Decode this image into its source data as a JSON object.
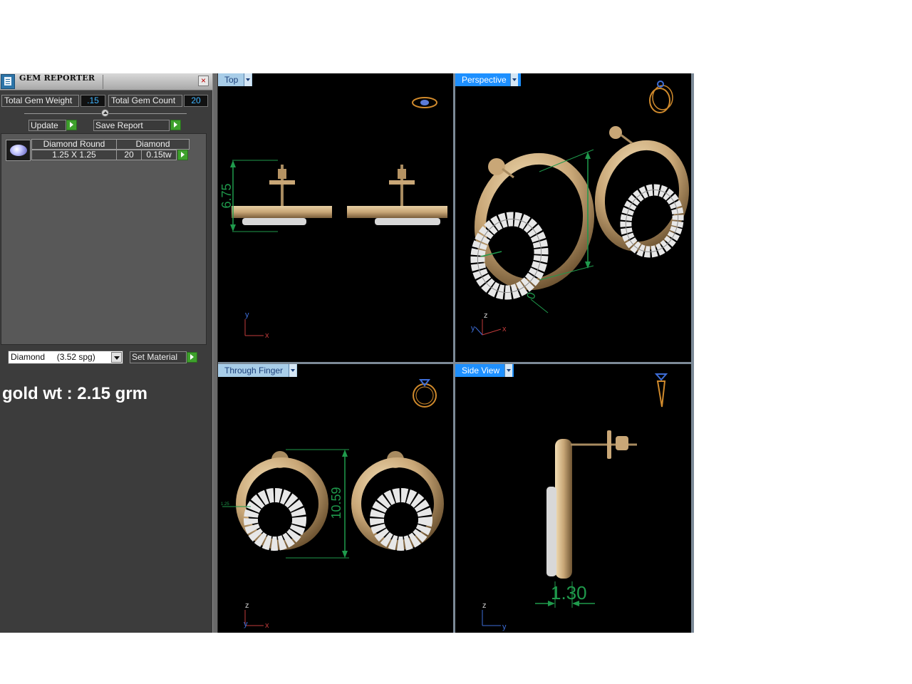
{
  "gem_reporter": {
    "title": "GEM REPORTER",
    "close": "×",
    "total_gem_weight_label": "Total Gem Weight",
    "total_gem_weight_value": ".15",
    "total_gem_count_label": "Total Gem Count",
    "total_gem_count_value": "20",
    "update_label": "Update",
    "save_report_label": "Save Report",
    "gems": [
      {
        "shape": "Diamond Round",
        "material": "Diamond",
        "size": "1.25 X 1.25",
        "count": "20",
        "weight": "0.15tw"
      }
    ]
  },
  "material": {
    "selected": "Diamond     (3.52 spg)",
    "set_material_label": "Set Material"
  },
  "gold_weight_text": "gold wt : 2.15 grm",
  "viewports": {
    "top": {
      "label": "Top",
      "dimension": "6.75"
    },
    "perspective": {
      "label": "Perspective",
      "dimension": "0"
    },
    "through_finger": {
      "label": "Through Finger",
      "dimension": "10.59",
      "small_dimension": "1.25"
    },
    "side": {
      "label": "Side View",
      "dimension": "1.30"
    }
  },
  "axis_labels": {
    "x": "x",
    "y": "y",
    "z": "z"
  },
  "colors": {
    "gold": "#c9a777",
    "dimension_green": "#1f9a4c",
    "viewport_tab": "#a8cde8",
    "viewport_tab_active": "#1e90ff",
    "gem_value_text": "#3fb5ff",
    "go_button": "#3ea12c"
  },
  "icons": {
    "logo": "gem-reporter-icon",
    "close": "close-icon",
    "go": "play-arrow-icon",
    "dropdown": "chevron-down-icon",
    "view_cube": "ring-view-icon"
  }
}
